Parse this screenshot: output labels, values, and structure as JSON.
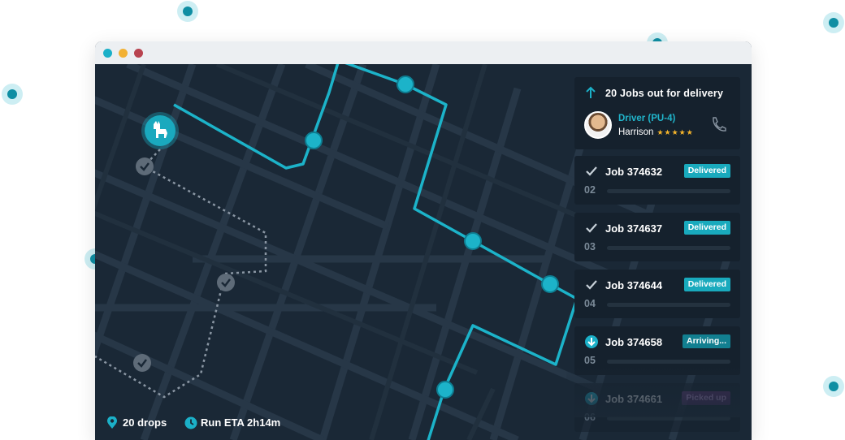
{
  "colors": {
    "accent": "#1bb0c8",
    "map_background": "#1a2836",
    "panel": "#15212d",
    "delivered": "#19aabd",
    "arriving": "#127f90",
    "picked_up": "#5a2f6b",
    "star": "#f4b42b"
  },
  "window": {
    "controls": [
      {
        "name": "minimize",
        "color": "#1bb0c8"
      },
      {
        "name": "maximize",
        "color": "#f2b134"
      },
      {
        "name": "close",
        "color": "#b8434f"
      }
    ]
  },
  "map": {
    "origin_icon": "llama-icon",
    "stop_icon": "route-stop-icon",
    "completed_icon": "check-circle-icon"
  },
  "delivery_panel": {
    "header_icon": "arrow-up-icon",
    "header": "20 Jobs out for delivery",
    "driver": {
      "label": "Driver (PU-4)",
      "name": "Harrison",
      "stars": "★★★★★",
      "rating": 5,
      "call_icon": "phone-icon"
    },
    "jobs": [
      {
        "icon": "check-icon",
        "title": "Job 374632",
        "number": "02",
        "status": "Delivered"
      },
      {
        "icon": "check-icon",
        "title": "Job 374637",
        "number": "03",
        "status": "Delivered"
      },
      {
        "icon": "check-icon",
        "title": "Job 374644",
        "number": "04",
        "status": "Delivered"
      },
      {
        "icon": "arrow-down-circle-icon",
        "title": "Job 374658",
        "number": "05",
        "status": "Arriving..."
      },
      {
        "icon": "arrow-down-circle-icon",
        "title": "Job 374661",
        "number": "06",
        "status": "Picked up"
      }
    ]
  },
  "footer": {
    "drops": "20 drops",
    "drops_icon": "location-pin-icon",
    "eta": "Run ETA 2h14m",
    "eta_icon": "clock-icon"
  }
}
